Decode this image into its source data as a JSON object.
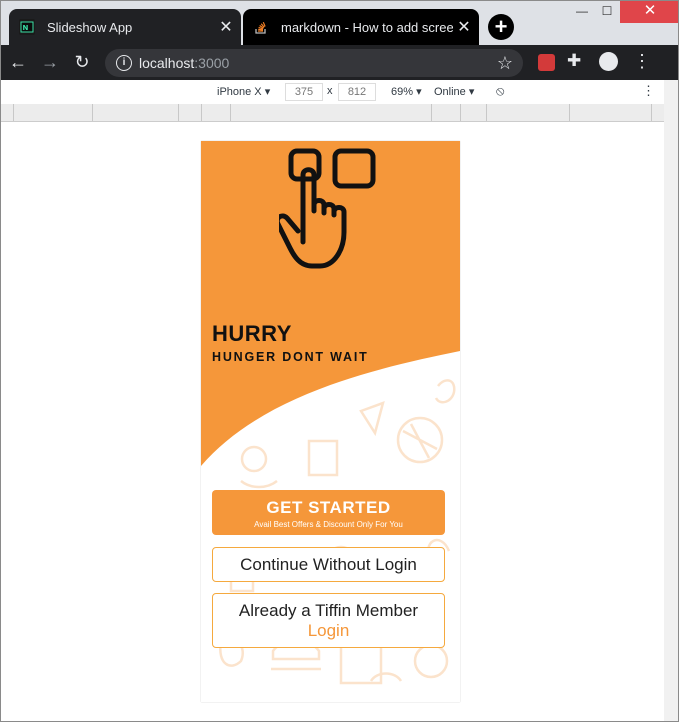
{
  "browser": {
    "tabs": [
      {
        "title": "Slideshow App",
        "favicon": "nextjs-favicon",
        "active": true
      },
      {
        "title": "markdown - How to add screens",
        "favicon": "stackoverflow-favicon",
        "active": false
      }
    ],
    "address": {
      "host": "localhost",
      "port": ":3000"
    },
    "window_controls": {
      "minimize": "—",
      "maximize": "☐",
      "close": "✕"
    }
  },
  "devtools": {
    "device": "iPhone X",
    "width": "375",
    "times": "x",
    "height": "812",
    "zoom": "69%",
    "network": "Online"
  },
  "app": {
    "headline": "HURRY",
    "subheadline": "HUNGER DONT WAIT",
    "get_started": {
      "label": "GET STARTED",
      "sublabel": "Avail Best Offers & Discount Only For You"
    },
    "continue_label": "Continue Without Login",
    "member_label": "Already a Tiffin Member",
    "login_label": "Login",
    "colors": {
      "accent": "#f5973a",
      "outline": "#f5a93e",
      "pattern": "#fbe3cc"
    },
    "illustration": "tap-hand-icon"
  }
}
